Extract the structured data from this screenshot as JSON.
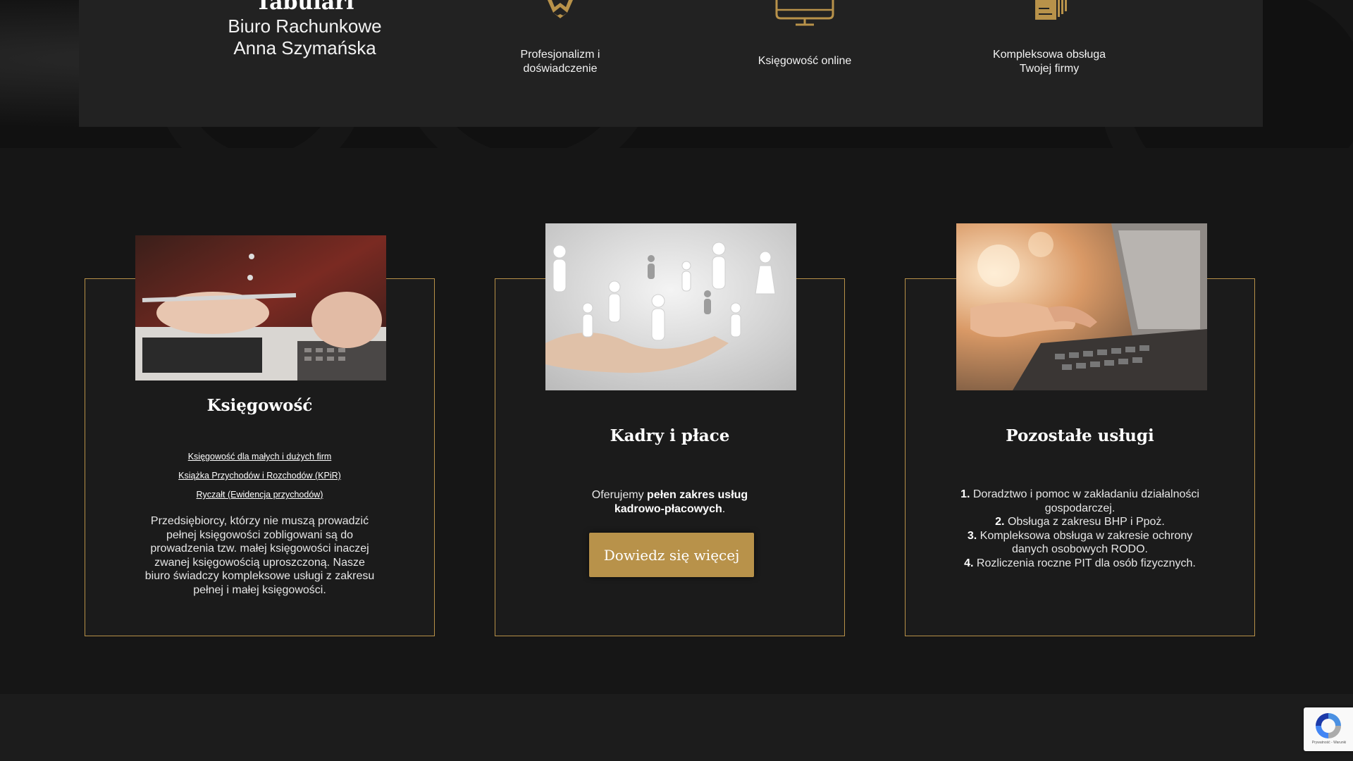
{
  "brand": {
    "name": "Tabulari",
    "line1": "Biuro Rachunkowe",
    "line2": "Anna Szymańska"
  },
  "features": [
    {
      "label_line1": "Profesjonalizm i",
      "label_line2": "doświadczenie",
      "icon": "award-badge-icon"
    },
    {
      "label_line1": "Księgowość online",
      "label_line2": "",
      "icon": "computer-monitor-icon"
    },
    {
      "label_line1": "Kompleksowa obsługa",
      "label_line2": "Twojej firmy",
      "icon": "documents-icon"
    }
  ],
  "colors": {
    "accent": "#b8924a",
    "background": "#161616",
    "panel": "#222222"
  },
  "cards": {
    "accounting": {
      "title": "Księgowość",
      "image": "hands-with-pen-and-calculator",
      "links": [
        "Księgowość dla małych i dużych firm",
        "Książka Przychodów i Rozchodów (KPiR)",
        "Ryczałt (Ewidencja przychodów)"
      ],
      "text": "Przedsiębiorcy, którzy nie muszą prowadzić pełnej księgowości zobligowani są do prowadzenia tzw. małej księgowości inaczej zwanej księgowością uproszczoną. Nasze biuro świadczy kompleksowe usługi z zakresu pełnej i małej księgowości."
    },
    "hr": {
      "title": "Kadry i płace",
      "image": "hand-holding-people-figures",
      "text_before": "Oferujemy ",
      "text_bold": "pełen zakres usług kadrowo-płacowych",
      "text_after": ".",
      "button": "Dowiedz się więcej"
    },
    "other": {
      "title": "Pozostałe usługi",
      "image": "hands-typing-on-laptop",
      "items": [
        {
          "num": "1.",
          "text": "Doradztwo i pomoc w zakładaniu działalności gospodarczej."
        },
        {
          "num": "2.",
          "text": "Obsługa z zakresu BHP i Ppoż."
        },
        {
          "num": "3.",
          "text": "Kompleksowa obsługa w zakresie ochrony danych osobowych RODO."
        },
        {
          "num": "4.",
          "text": "Rozliczenia roczne PIT dla osób fizycznych."
        }
      ]
    }
  },
  "recaptcha": {
    "text": "Prywatność - Warunki"
  }
}
